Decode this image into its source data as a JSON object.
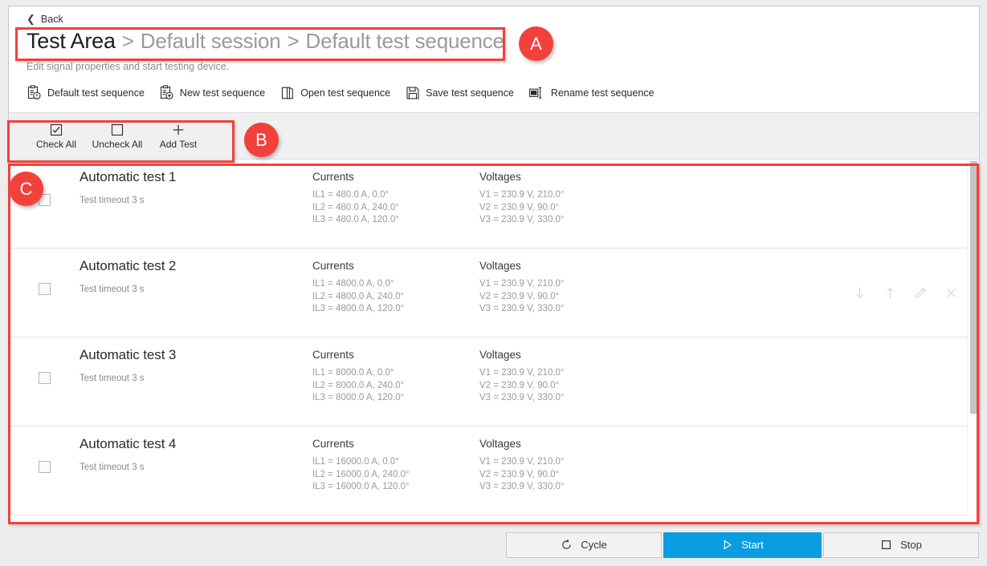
{
  "back": {
    "label": "Back",
    "icon": "chevron-left-icon"
  },
  "header": {
    "crumb_main": "Test Area",
    "sep1": ">",
    "crumb_session": "Default session",
    "sep2": ">",
    "crumb_sequence": "Default test sequence",
    "subtitle": "Edit signal properties and start testing device."
  },
  "commands": [
    {
      "label": "Default test sequence",
      "icon": "clipboard-default-icon"
    },
    {
      "label": "New test sequence",
      "icon": "clipboard-new-icon"
    },
    {
      "label": "Open test sequence",
      "icon": "open-folder-icon"
    },
    {
      "label": "Save test sequence",
      "icon": "floppy-save-icon"
    },
    {
      "label": "Rename test sequence",
      "icon": "rename-icon"
    }
  ],
  "toolbar": [
    {
      "label": "Check All",
      "icon": "checkbox-checked-icon"
    },
    {
      "label": "Uncheck All",
      "icon": "checkbox-empty-icon"
    },
    {
      "label": "Add Test",
      "icon": "plus-icon"
    }
  ],
  "list": {
    "currents_header": "Currents",
    "voltages_header": "Voltages",
    "row_actions": [
      {
        "name": "move-down-icon",
        "title": "Move down"
      },
      {
        "name": "move-up-icon",
        "title": "Move up"
      },
      {
        "name": "edit-pencil-icon",
        "title": "Edit"
      },
      {
        "name": "delete-close-icon",
        "title": "Delete"
      }
    ],
    "rows": [
      {
        "title": "Automatic test 1",
        "timeout": "Test timeout 3 s",
        "checked": false,
        "currents": [
          "IL1 = 480.0 A, 0.0°",
          "IL2 = 480.0 A, 240.0°",
          "IL3 = 480.0 A, 120.0°"
        ],
        "voltages": [
          "V1 = 230.9 V, 210.0°",
          "V2 = 230.9 V, 90.0°",
          "V3 = 230.9 V, 330.0°"
        ],
        "actions_visible": false
      },
      {
        "title": "Automatic test 2",
        "timeout": "Test timeout 3 s",
        "checked": false,
        "currents": [
          "IL1 = 4800.0 A, 0.0°",
          "IL2 = 4800.0 A, 240.0°",
          "IL3 = 4800.0 A, 120.0°"
        ],
        "voltages": [
          "V1 = 230.9 V, 210.0°",
          "V2 = 230.9 V, 90.0°",
          "V3 = 230.9 V, 330.0°"
        ],
        "actions_visible": true
      },
      {
        "title": "Automatic test 3",
        "timeout": "Test timeout 3 s",
        "checked": false,
        "currents": [
          "IL1 = 8000.0 A, 0.0°",
          "IL2 = 8000.0 A, 240.0°",
          "IL3 = 8000.0 A, 120.0°"
        ],
        "voltages": [
          "V1 = 230.9 V, 210.0°",
          "V2 = 230.9 V, 90.0°",
          "V3 = 230.9 V, 330.0°"
        ],
        "actions_visible": false
      },
      {
        "title": "Automatic test 4",
        "timeout": "Test timeout 3 s",
        "checked": false,
        "currents": [
          "IL1 = 16000.0 A, 0.0°",
          "IL2 = 16000.0 A, 240.0°",
          "IL3 = 16000.0 A, 120.0°"
        ],
        "voltages": [
          "V1 = 230.9 V, 210.0°",
          "V2 = 230.9 V, 90.0°",
          "V3 = 230.9 V, 330.0°"
        ],
        "actions_visible": false
      }
    ]
  },
  "footer": {
    "cycle": {
      "label": "Cycle",
      "icon": "refresh-cycle-icon"
    },
    "start": {
      "label": "Start",
      "icon": "play-triangle-icon"
    },
    "stop": {
      "label": "Stop",
      "icon": "stop-square-icon"
    }
  },
  "annotations": [
    {
      "letter": "A",
      "target": "breadcrumb-header"
    },
    {
      "letter": "B",
      "target": "check-toolbar"
    },
    {
      "letter": "C",
      "target": "test-list"
    }
  ],
  "colors": {
    "accent_blue": "#0b9de2",
    "annotation_red": "#f2403c",
    "toolbar_grey": "#f0f0f0",
    "page_grey": "#ededed"
  }
}
